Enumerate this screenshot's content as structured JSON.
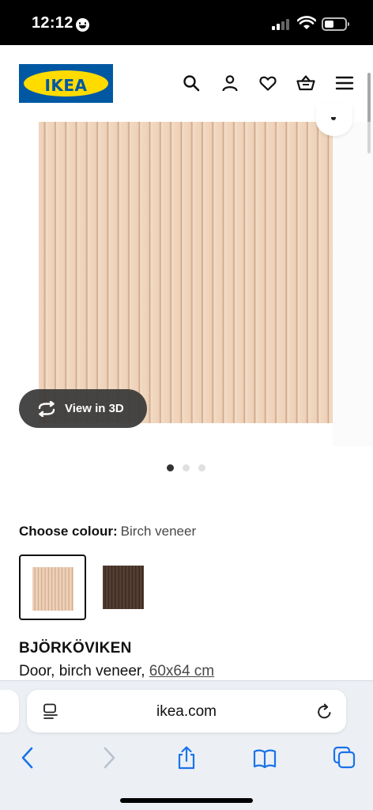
{
  "status_bar": {
    "time": "12:12",
    "battery_level": 0.45,
    "signal_bars": 2
  },
  "header": {
    "logo_text": "IKEA",
    "icons": [
      "search-icon",
      "account-icon",
      "heart-icon",
      "basket-icon",
      "menu-icon"
    ]
  },
  "gallery": {
    "view3d_label": "View in 3D",
    "dot_count": 3,
    "active_dot": 0
  },
  "colour": {
    "label": "Choose colour:",
    "value": "Birch veneer",
    "swatches": [
      "Birch veneer",
      "Dark"
    ]
  },
  "product": {
    "name": "BJÖRKÖVIKEN",
    "desc_prefix": "Door, birch veneer,",
    "size": "60x64 cm"
  },
  "browser": {
    "url": "ikea.com",
    "toolbar": [
      "back-icon",
      "forward-icon",
      "share-icon",
      "bookmarks-icon",
      "tabs-icon"
    ]
  },
  "colors": {
    "ikea_blue": "#0058a3",
    "ikea_yellow": "#ffdb00",
    "ios_blue": "#1a73e8"
  }
}
